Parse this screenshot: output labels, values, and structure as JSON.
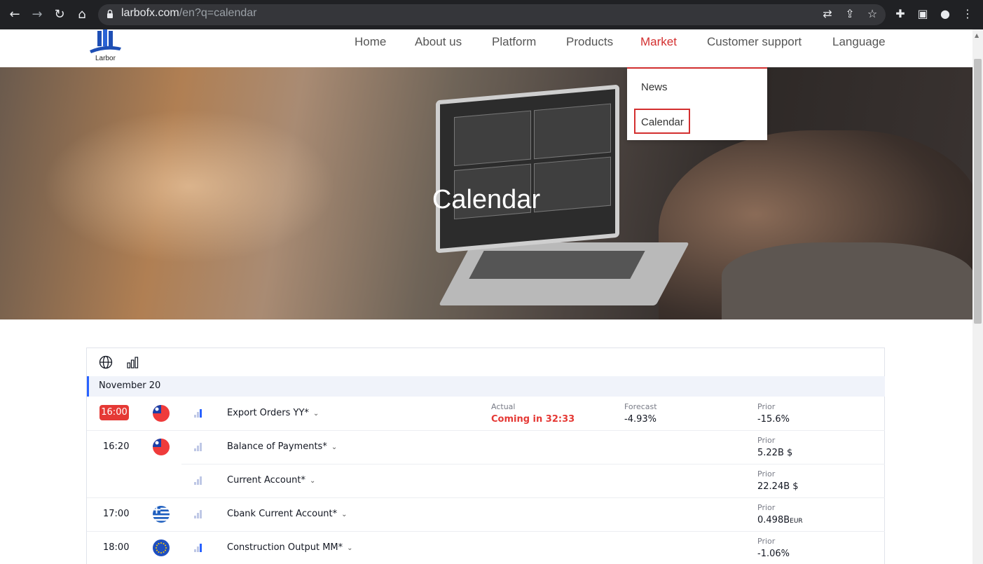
{
  "browser": {
    "url_host": "larbofx.com",
    "url_path": "/en?q=calendar",
    "icons": [
      "back-arrow-icon",
      "forward-arrow-icon",
      "reload-icon",
      "home-icon",
      "lock-icon",
      "translate-icon",
      "share-icon",
      "star-icon",
      "extensions-icon",
      "side-panel-icon",
      "profile-icon",
      "more-icon"
    ]
  },
  "header": {
    "logo_text": "Larbor",
    "menu": [
      {
        "label": "Home"
      },
      {
        "label": "About us"
      },
      {
        "label": "Platform"
      },
      {
        "label": "Products"
      },
      {
        "label": "Market",
        "active": true
      },
      {
        "label": "Customer support"
      },
      {
        "label": "Language"
      }
    ],
    "active_color": "#d32f2f"
  },
  "dropdown": {
    "items": [
      {
        "label": "News"
      },
      {
        "label": "Calendar",
        "highlighted": true
      }
    ]
  },
  "hero": {
    "title": "Calendar"
  },
  "calendar": {
    "toolbar_icons": [
      "globe-icon",
      "importance-bars-icon"
    ],
    "date": "November 20",
    "columns": {
      "actual": "Actual",
      "forecast": "Forecast",
      "prior": "Prior"
    },
    "events": [
      {
        "time": "16:00",
        "highlighted": true,
        "flag": "taiwan-flag",
        "name": "Export Orders YY*",
        "actual": "Coming in 32:33",
        "forecast": "-4.93%",
        "prior": "-15.6%"
      },
      {
        "time": "16:20",
        "flag": "taiwan-flag",
        "name": "Balance of Payments*",
        "prior": "5.22B $"
      },
      {
        "time": "",
        "flag": "",
        "name": "Current Account*",
        "prior": "22.24B $"
      },
      {
        "time": "17:00",
        "flag": "greece-flag",
        "name": "Cbank Current Account*",
        "prior_value": "0.498B",
        "prior_unit": "EUR"
      },
      {
        "time": "18:00",
        "flag": "eu-flag",
        "name": "Construction Output MM*",
        "prior": "-1.06%"
      }
    ]
  }
}
